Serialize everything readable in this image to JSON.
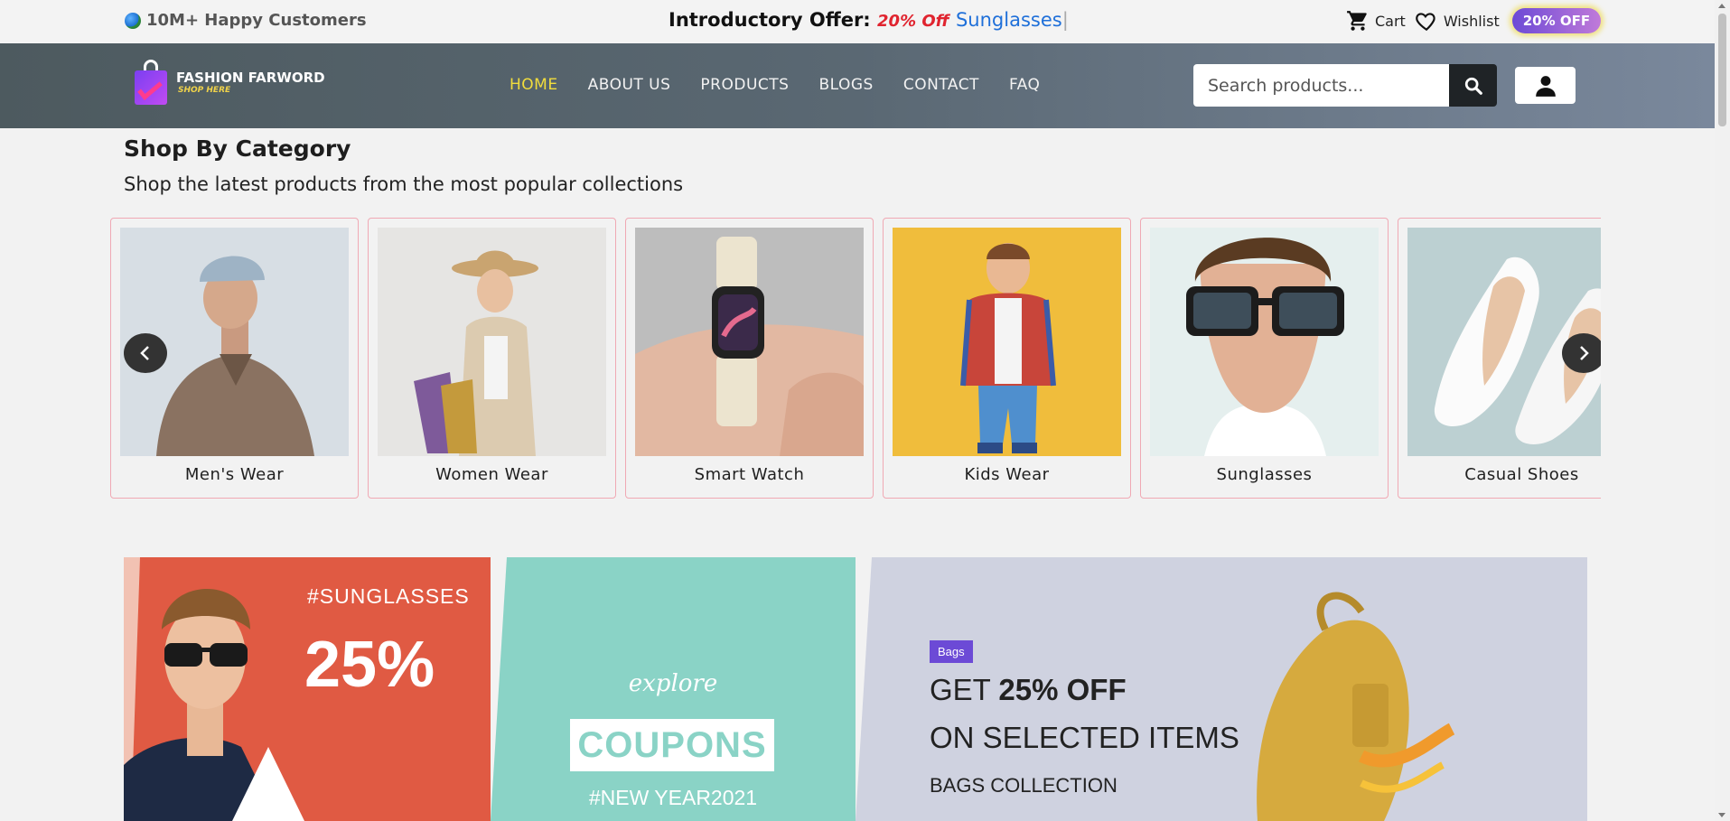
{
  "topbar": {
    "customers": "10M+ Happy Customers",
    "offer_label": "Introductory Offer:",
    "offer_pct": "20% Off",
    "offer_product": "Sunglasses",
    "cart": "Cart",
    "wishlist": "Wishlist",
    "badge": "20% OFF"
  },
  "logo": {
    "name": "FASHION FARWORD",
    "tagline": "SHOP HERE"
  },
  "nav": [
    "HOME",
    "ABOUT US",
    "PRODUCTS",
    "BLOGS",
    "CONTACT",
    "FAQ"
  ],
  "nav_active": "HOME",
  "search": {
    "placeholder": "Search products..."
  },
  "category": {
    "title": "Shop By Category",
    "subtitle": "Shop the latest products from the most popular collections",
    "items": [
      "Men's Wear",
      "Women Wear",
      "Smart Watch",
      "Kids Wear",
      "Sunglasses",
      "Casual Shoes"
    ]
  },
  "banners": {
    "sunglasses_tag": "#SUNGLASSES",
    "sunglasses_pct": "25%",
    "coupons_explore": "explore",
    "coupons_word": "COUPONS",
    "coupons_tag": "#NEW YEAR2021",
    "bags_badge": "Bags",
    "bags_line1_prefix": "GET",
    "bags_line1_bold": "25% OFF",
    "bags_line2": "ON SELECTED ITEMS",
    "bags_line3": "BAGS COLLECTION"
  },
  "colors": {
    "nav_active": "#f2dd3c",
    "offer_pct": "#e0242f",
    "offer_product": "#1e6fd9",
    "card_border": "#f0a9b4",
    "badge_start": "#6c4ad6",
    "badge_end": "#c07ad9"
  }
}
